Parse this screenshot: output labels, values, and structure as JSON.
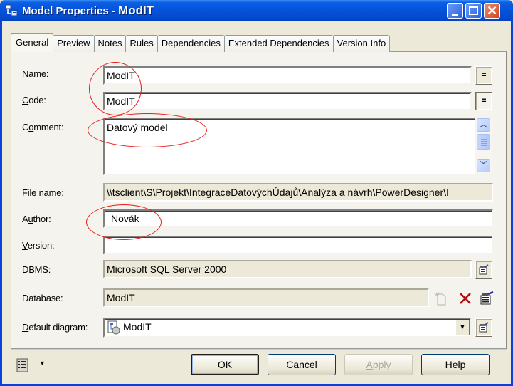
{
  "window": {
    "title_prefix": "Model Properties - ",
    "title_model": "ModIT",
    "controls": {
      "minimize": "minimize",
      "maximize": "maximize",
      "close": "close"
    }
  },
  "tabs": [
    {
      "label": "General",
      "active": true
    },
    {
      "label": "Preview",
      "active": false
    },
    {
      "label": "Notes",
      "active": false
    },
    {
      "label": "Rules",
      "active": false
    },
    {
      "label": "Dependencies",
      "active": false
    },
    {
      "label": "Extended Dependencies",
      "active": false
    },
    {
      "label": "Version Info",
      "active": false
    }
  ],
  "form": {
    "name": {
      "label_accel": "N",
      "label_rest": "ame:",
      "value": "ModIT",
      "button": "="
    },
    "code": {
      "label_accel": "C",
      "label_rest": "ode:",
      "value": "ModIT",
      "button": "="
    },
    "comment": {
      "label_pre": "C",
      "label_accel": "o",
      "label_rest": "mment:",
      "value": "Datový model"
    },
    "file_name": {
      "label_accel": "F",
      "label_rest": "ile name:",
      "value": "\\\\tsclient\\S\\Projekt\\IntegraceDatovýchÚdajů\\Analýza a návrh\\PowerDesigner\\I"
    },
    "author": {
      "label_pre": "A",
      "label_accel": "u",
      "label_rest": "thor:",
      "value": "Novák"
    },
    "version": {
      "label_accel": "V",
      "label_rest": "ersion:",
      "value": ""
    },
    "dbms": {
      "label": "DBMS:",
      "value": "Microsoft SQL Server 2000"
    },
    "database": {
      "label": "Database:",
      "value": "ModIT"
    },
    "default_diagram": {
      "label_accel": "D",
      "label_rest": "efault diagram:",
      "value": "ModIT"
    }
  },
  "buttons": {
    "ok": "OK",
    "cancel": "Cancel",
    "apply_accel": "A",
    "apply_rest": "pply",
    "help": "Help"
  },
  "annotations": {
    "color": "#e8201c",
    "highlighted": [
      "name",
      "code",
      "comment",
      "author"
    ]
  },
  "colors": {
    "titlebar": "#0552d8",
    "dialog_bg": "#ece9d8",
    "active_tab_accent": "#e68b2c",
    "delete_icon": "#b01010"
  }
}
